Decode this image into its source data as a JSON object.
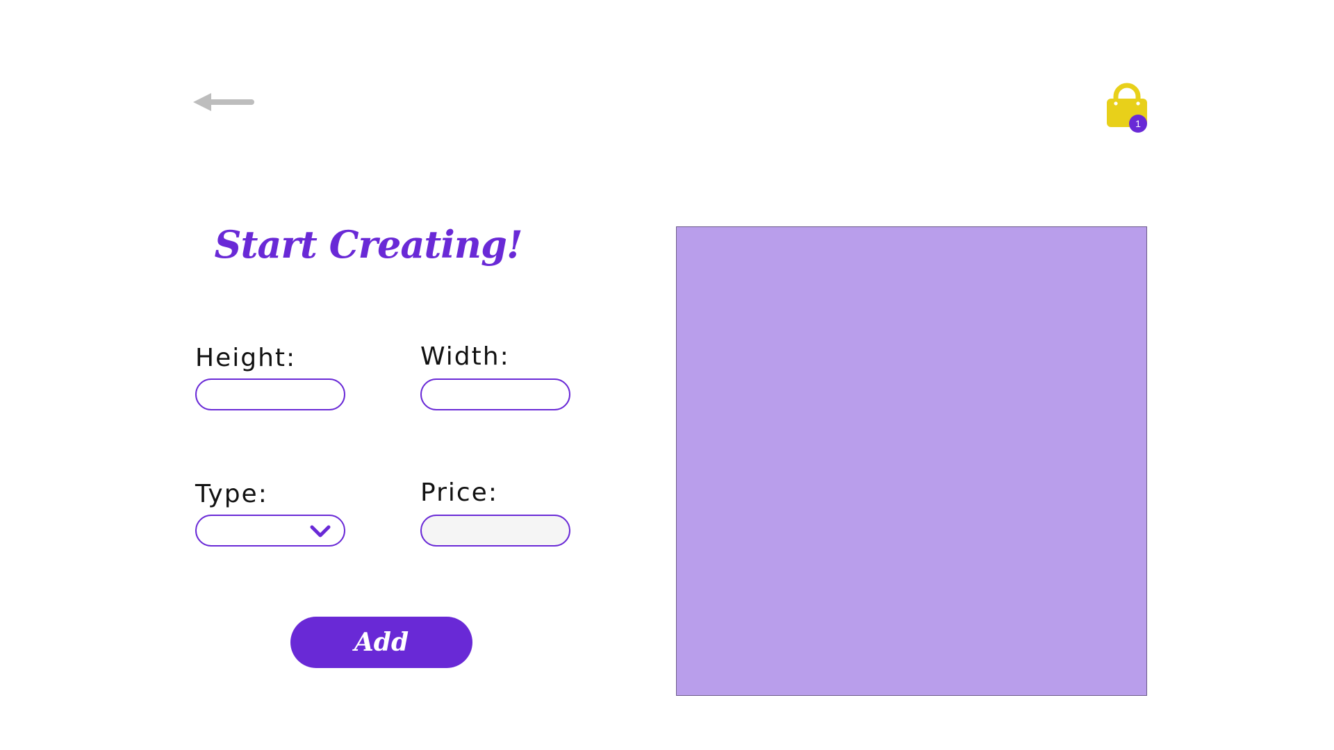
{
  "colors": {
    "accent": "#6929d6",
    "icon_gray": "#bdbdbd",
    "bag_yellow": "#e8d01a",
    "preview_fill": "#b99eeb",
    "disabled_fill": "#f5f5f5"
  },
  "header": {
    "back_icon": "arrow-left-icon",
    "cart_icon": "shopping-bag-icon",
    "cart_count": "1"
  },
  "form": {
    "title": "Start Creating!",
    "height": {
      "label": "Height:",
      "value": ""
    },
    "width": {
      "label": "Width:",
      "value": ""
    },
    "type": {
      "label": "Type:",
      "value": "",
      "icon": "chevron-down-icon"
    },
    "price": {
      "label": "Price:",
      "value": "",
      "disabled": true
    },
    "add_label": "Add"
  },
  "preview": {
    "color": "#b99eeb"
  }
}
